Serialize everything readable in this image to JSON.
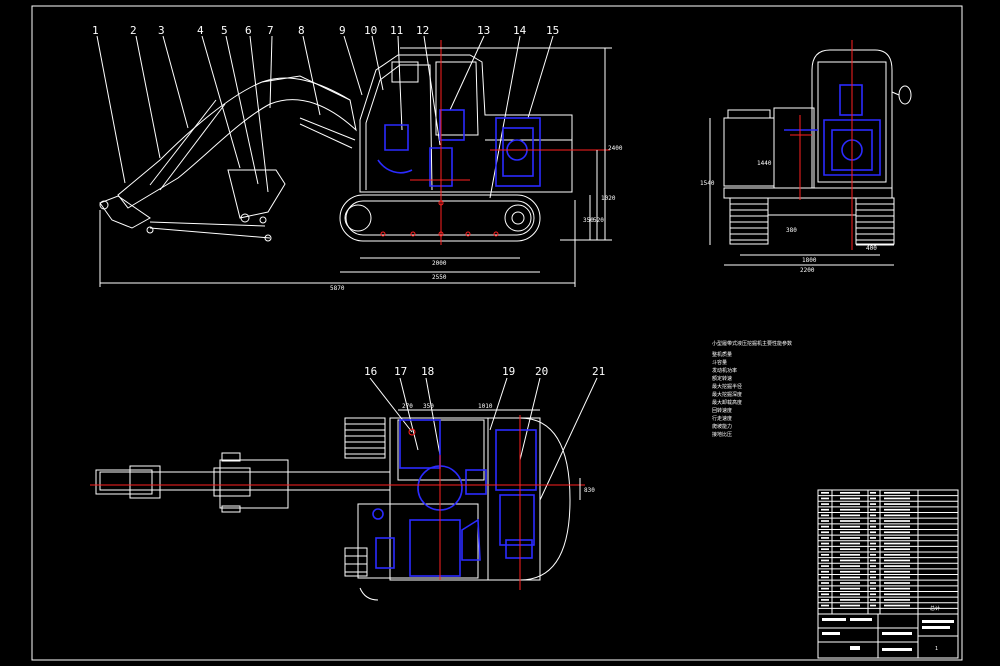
{
  "part_numbers": [
    "1",
    "2",
    "3",
    "4",
    "5",
    "6",
    "7",
    "8",
    "9",
    "10",
    "11",
    "12",
    "13",
    "14",
    "15",
    "16",
    "17",
    "18",
    "19",
    "20",
    "21"
  ],
  "dims_side": {
    "overall_length": "5870",
    "track_length": "2550",
    "track_contact": "2000",
    "cab_height": "2400",
    "dim_a": "1020",
    "dim_b": "520",
    "dim_c": "350"
  },
  "dims_front": {
    "overall_width": "2200",
    "track_gauge": "1800",
    "height": "1540",
    "shoe": "400",
    "gap": "380",
    "side": "1440"
  },
  "dims_top": {
    "d1": "270",
    "d2": "350",
    "d3": "1010",
    "d4": "830"
  },
  "spec_table": {
    "title": "小型履带式液压挖掘机主要性能参数",
    "rows": [
      "整机质量",
      "斗容量",
      "发动机功率",
      "额定转速",
      "最大挖掘半径",
      "最大挖掘深度",
      "最大卸载高度",
      "回转速度",
      "行走速度",
      "爬坡能力",
      "接地比压"
    ]
  },
  "parts_list": {
    "rows": 22,
    "footer_label": "总计",
    "sheet_number": "1"
  }
}
